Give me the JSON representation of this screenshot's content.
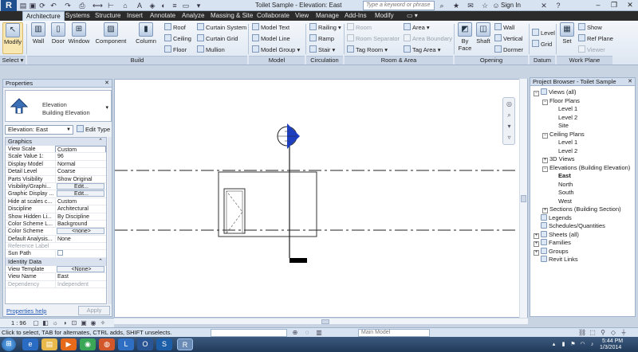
{
  "titlebar": {
    "app_logo": "R",
    "title": "Toilet Sample - Elevation: East",
    "search_placeholder": "Type a keyword or phrase",
    "sign_in": "Sign In",
    "qat_icons": [
      "open-icon",
      "save-icon",
      "undo-icon",
      "redo-icon",
      "print-icon",
      "measure-icon",
      "text-icon"
    ]
  },
  "ribbon_tabs": [
    "Architecture",
    "Systems",
    "Structure",
    "Insert",
    "Annotate",
    "Analyze",
    "Massing & Site",
    "Collaborate",
    "View",
    "Manage",
    "Add-Ins",
    "Modify"
  ],
  "ribbon": {
    "select": {
      "modify": "Modify",
      "label": "Select ▾"
    },
    "build": {
      "label": "Build",
      "big": [
        "Wall",
        "Door",
        "Window",
        "Component",
        "Column"
      ],
      "small": [
        "Roof",
        "Ceiling",
        "Floor",
        "Curtain System",
        "Curtain Grid",
        "Mullion"
      ]
    },
    "model": {
      "label": "Model",
      "items": [
        "Model Text",
        "Model Line",
        "Model Group"
      ]
    },
    "circulation": {
      "label": "Circulation",
      "items": [
        "Railing",
        "Ramp",
        "Stair"
      ]
    },
    "room_area": {
      "label": "Room & Area",
      "items": [
        "Room",
        "Room Separator",
        "Tag Room",
        "Area",
        "Area Boundary",
        "Tag Area"
      ]
    },
    "opening": {
      "label": "Opening",
      "big": [
        "By Face",
        "Shaft"
      ],
      "small": [
        "Wall",
        "Vertical",
        "Dormer"
      ]
    },
    "datum": {
      "label": "Datum",
      "items": [
        "Level",
        "Grid"
      ]
    },
    "work_plane": {
      "label": "Work Plane",
      "set": "Set",
      "items": [
        "Show",
        "Ref Plane",
        "Viewer"
      ]
    }
  },
  "properties": {
    "header": "Properties",
    "type_family": "Elevation",
    "type_name": "Building Elevation",
    "filter": "Elevation: East",
    "edit_type": "Edit Type",
    "groups": [
      {
        "name": "Graphics",
        "rows": [
          {
            "key": "View Scale",
            "value": "Custom",
            "style": "boxed"
          },
          {
            "key": "Scale Value    1:",
            "value": "96"
          },
          {
            "key": "Display Model",
            "value": "Normal"
          },
          {
            "key": "Detail Level",
            "value": "Coarse"
          },
          {
            "key": "Parts Visibility",
            "value": "Show Original"
          },
          {
            "key": "Visibility/Graphi...",
            "value": "Edit...",
            "style": "btn"
          },
          {
            "key": "Graphic Display ...",
            "value": "Edit...",
            "style": "btn"
          },
          {
            "key": "Hide at scales c...",
            "value": "Custom"
          },
          {
            "key": "Discipline",
            "value": "Architectural"
          },
          {
            "key": "Show Hidden Li...",
            "value": "By Discipline"
          },
          {
            "key": "Color Scheme L...",
            "value": "Background"
          },
          {
            "key": "Color Scheme",
            "value": "<none>",
            "style": "btn"
          },
          {
            "key": "Default Analysis...",
            "value": "None"
          },
          {
            "key": "Reference Label",
            "value": "",
            "style": "dim"
          },
          {
            "key": "Sun Path",
            "value": "",
            "style": "check"
          }
        ]
      },
      {
        "name": "Identity Data",
        "rows": [
          {
            "key": "View Template",
            "value": "<None>",
            "style": "btn"
          },
          {
            "key": "View Name",
            "value": "East"
          },
          {
            "key": "Dependency",
            "value": "Independent",
            "style": "dim"
          }
        ]
      }
    ],
    "help_link": "Properties help",
    "apply": "Apply"
  },
  "view_control": {
    "scale": "1 : 96"
  },
  "browser": {
    "header": "Project Browser - Toilet Sample",
    "nodes": [
      {
        "label": "Views (all)",
        "level": 0,
        "toggle": "−",
        "icon": true
      },
      {
        "label": "Floor Plans",
        "level": 1,
        "toggle": "−"
      },
      {
        "label": "Level 1",
        "level": 2
      },
      {
        "label": "Level 2",
        "level": 2
      },
      {
        "label": "Site",
        "level": 2
      },
      {
        "label": "Ceiling Plans",
        "level": 1,
        "toggle": "−"
      },
      {
        "label": "Level 1",
        "level": 2
      },
      {
        "label": "Level 2",
        "level": 2
      },
      {
        "label": "3D Views",
        "level": 1,
        "toggle": "+"
      },
      {
        "label": "Elevations (Building Elevation)",
        "level": 1,
        "toggle": "−"
      },
      {
        "label": "East",
        "level": 2,
        "bold": true
      },
      {
        "label": "North",
        "level": 2
      },
      {
        "label": "South",
        "level": 2
      },
      {
        "label": "West",
        "level": 2
      },
      {
        "label": "Sections (Building Section)",
        "level": 1,
        "toggle": "+"
      },
      {
        "label": "Legends",
        "level": 0,
        "icon": true
      },
      {
        "label": "Schedules/Quantities",
        "level": 0,
        "icon": true
      },
      {
        "label": "Sheets (all)",
        "level": 0,
        "toggle": "+",
        "icon": true
      },
      {
        "label": "Families",
        "level": 0,
        "toggle": "+",
        "icon": true
      },
      {
        "label": "Groups",
        "level": 0,
        "toggle": "+",
        "icon": true
      },
      {
        "label": "Revit Links",
        "level": 0,
        "icon": true
      }
    ]
  },
  "statusbar": {
    "message": "Click to select, TAB for alternates, CTRL adds, SHIFT unselects.",
    "model": "Main Model"
  },
  "taskbar": {
    "apps": [
      "start-orb",
      "ie-icon",
      "explorer-icon",
      "media-icon",
      "chrome-icon",
      "firefox-icon",
      "lync-icon",
      "revit-icon"
    ],
    "time": "5:44 PM",
    "date": "1/3/2014"
  },
  "colors": {
    "accent": "#1f4f8c",
    "elevation_marker": "#1d3fbf",
    "ribbon_bg": "#dde6f1"
  }
}
